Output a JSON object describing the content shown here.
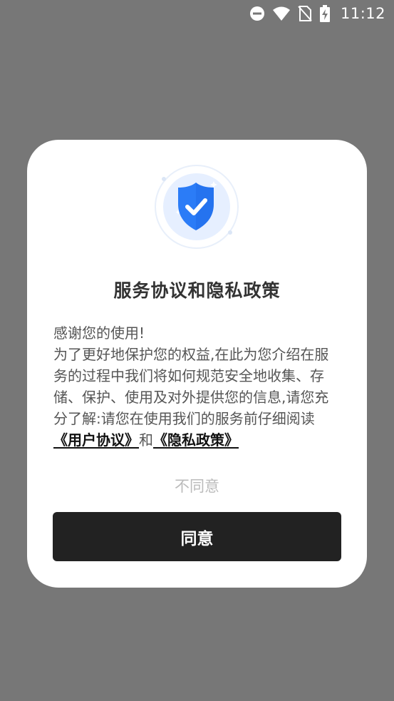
{
  "status_bar": {
    "time": "11:12",
    "icons": [
      "do-not-disturb-icon",
      "wifi-icon",
      "no-sim-icon",
      "battery-charging-icon"
    ]
  },
  "dialog": {
    "title": "服务协议和隐私政策",
    "greeting": "感谢您的使用!",
    "body_text": "为了更好地保护您的权益,在此为您介绍在服务的过程中我们将如何规范安全地收集、存储、保护、使用及对外提供您的信息,请您充分了解:请您在使用我们的服务前仔细阅读",
    "user_agreement_link": "《用户协议》",
    "conjunction": "和",
    "privacy_policy_link": "《隐私政策》",
    "disagree_label": "不同意",
    "agree_label": "同意"
  },
  "colors": {
    "overlay": "#777777",
    "shield": "#2b7cf7",
    "button": "#222222",
    "disagree_text": "#bbbbbb"
  }
}
